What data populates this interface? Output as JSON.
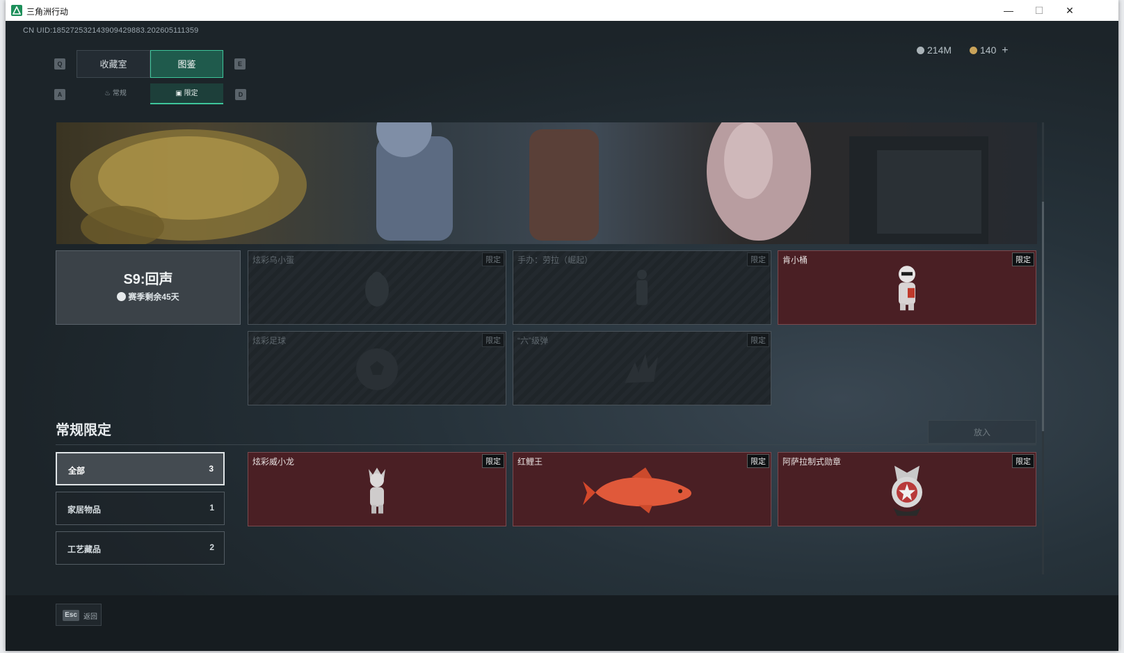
{
  "window": {
    "title": "三角洲行动",
    "controls": {
      "minimize": "—",
      "maximize": "☐",
      "close": "✕"
    }
  },
  "header": {
    "uid": "CN UID:185272532143909429883.202605111359",
    "currency": [
      {
        "icon": "silver-coin-icon",
        "value": "214M"
      },
      {
        "icon": "gold-coin-icon",
        "value": "140"
      }
    ],
    "add_label": "+"
  },
  "tabs": {
    "prev_key": "Q",
    "next_key": "E",
    "items": [
      {
        "label": "收藏室",
        "active": false
      },
      {
        "label": "图鉴",
        "active": true
      }
    ]
  },
  "subtabs": {
    "prev_key": "A",
    "next_key": "D",
    "items": [
      {
        "label": "常规",
        "active": false
      },
      {
        "label": "限定",
        "active": true
      }
    ]
  },
  "season": {
    "title": "S9:回声",
    "remaining": "赛季剩余45天"
  },
  "season_cards": [
    {
      "name": "炫彩乌小蛋",
      "tag": "限定",
      "owned": false
    },
    {
      "name": "手办：劳拉（崛起）",
      "tag": "限定",
      "owned": false
    },
    {
      "name": "肯小桶",
      "tag": "限定",
      "owned": true
    },
    {
      "name": "炫彩足球",
      "tag": "限定",
      "owned": false
    },
    {
      "name": "“六”级弹",
      "tag": "限定",
      "owned": false
    }
  ],
  "regular": {
    "title": "常规限定",
    "place_button": "放入",
    "filters": [
      {
        "label": "全部",
        "count": "3",
        "active": true
      },
      {
        "label": "家居物品",
        "count": "1",
        "active": false
      },
      {
        "label": "工艺藏品",
        "count": "2",
        "active": false
      }
    ],
    "cards": [
      {
        "name": "炫彩威小龙",
        "tag": "限定"
      },
      {
        "name": "红鲤王",
        "tag": "限定"
      },
      {
        "name": "阿萨拉制式勋章",
        "tag": "限定"
      }
    ]
  },
  "footer": {
    "esc_key": "Esc",
    "back_label": "返回"
  },
  "colors": {
    "accent": "#3ec59a",
    "owned_card": "#4a1f24",
    "background": "#1c2429"
  }
}
